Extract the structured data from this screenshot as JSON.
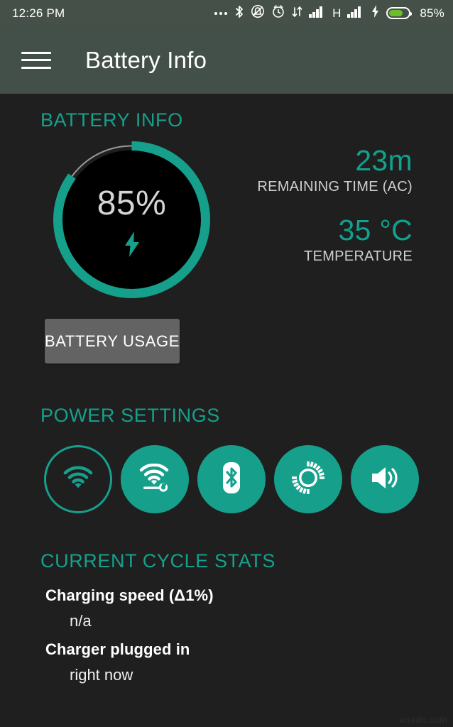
{
  "statusbar": {
    "clock": "12:26 PM",
    "icons": [
      {
        "name": "more-dots-icon",
        "glyph": "…"
      },
      {
        "name": "bluetooth-icon",
        "glyph": "bt"
      },
      {
        "name": "ringer-off-icon",
        "glyph": "bell-slash"
      },
      {
        "name": "alarm-icon",
        "glyph": "alarm"
      },
      {
        "name": "data-transfer-icon",
        "glyph": "up-down-arrows"
      },
      {
        "name": "signal-bars-sim1-icon",
        "glyph": "bars"
      },
      {
        "name": "network-type-label",
        "glyph": "H"
      },
      {
        "name": "signal-bars-sim2-icon",
        "glyph": "bars"
      },
      {
        "name": "charging-bolt-icon",
        "glyph": "bolt"
      },
      {
        "name": "battery-icon",
        "glyph": "battery"
      }
    ],
    "network_type": "H",
    "battery_percent_label": "85%",
    "battery_fill_percent": 72,
    "battery_fill_color": "#6abf2b"
  },
  "appbar": {
    "menu_icon": "hamburger-menu-icon",
    "title": "Battery Info",
    "background_color": "#435049"
  },
  "theme": {
    "background": "#1f1f1f",
    "accent": "#16a08c",
    "accent_value": "#11a18c",
    "text_primary": "#ffffff",
    "text_secondary": "#cfcfcf",
    "button_gray": "#636363"
  },
  "battery_info": {
    "section_title": "BATTERY INFO",
    "gauge": {
      "percent_label": "85%",
      "percent_value": 85,
      "track_color": "#9a9a9a",
      "arc_color": "#16a08c",
      "inner_color": "#000000",
      "charging_icon": "lightning-bolt-icon"
    },
    "stats": [
      {
        "value": "23m",
        "label": "REMAINING TIME (AC)"
      },
      {
        "value": "35 °C",
        "label": "TEMPERATURE"
      }
    ],
    "usage_button_label": "BATTERY USAGE"
  },
  "power_settings": {
    "section_title": "POWER SETTINGS",
    "toggles": [
      {
        "name": "wifi-toggle",
        "icon": "wifi-icon",
        "state": "off"
      },
      {
        "name": "wifi-settings-toggle",
        "icon": "wifi-wrench-icon",
        "state": "on"
      },
      {
        "name": "bluetooth-toggle",
        "icon": "bluetooth-icon",
        "state": "on"
      },
      {
        "name": "brightness-toggle",
        "icon": "sun-brightness-icon",
        "state": "on"
      },
      {
        "name": "volume-toggle",
        "icon": "volume-speaker-icon",
        "state": "on"
      }
    ]
  },
  "cycle_stats": {
    "section_title": "CURRENT CYCLE STATS",
    "rows": [
      {
        "key": "Charging speed (Δ1%)",
        "value": "n/a"
      },
      {
        "key": "Charger plugged in",
        "value": "right now"
      }
    ]
  },
  "watermark": "wsxdn.com"
}
